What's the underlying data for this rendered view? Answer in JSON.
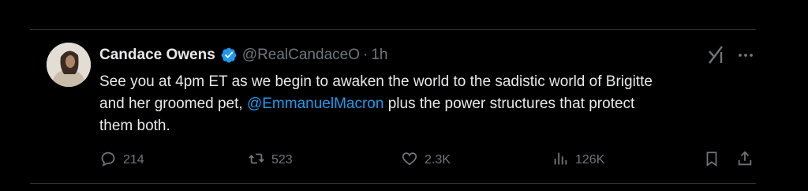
{
  "tweet": {
    "author": {
      "name": "Candace Owens",
      "handle": "@RealCandaceO",
      "verified": true
    },
    "separator": "·",
    "time": "1h",
    "text": {
      "line1": "See you at 4pm ET as we begin to awaken the world to the sadistic world of Brigitte",
      "line2_before": "and her groomed pet, ",
      "mention": "@EmmanuelMacron",
      "line2_after": " plus the power structures that protect",
      "line3": "them both."
    },
    "stats": {
      "replies": "214",
      "reposts": "523",
      "likes": "2.3K",
      "views": "126K"
    }
  },
  "colors": {
    "background": "#000000",
    "text": "#e7e9ea",
    "muted": "#71767b",
    "accent": "#1d9bf0",
    "border": "#2f3336"
  },
  "icons": {
    "verified": "verified-badge-icon",
    "grok": "grok-icon",
    "more": "more-icon",
    "reply": "reply-icon",
    "repost": "repost-icon",
    "like": "like-icon",
    "views": "views-icon",
    "bookmark": "bookmark-icon",
    "share": "share-icon"
  }
}
